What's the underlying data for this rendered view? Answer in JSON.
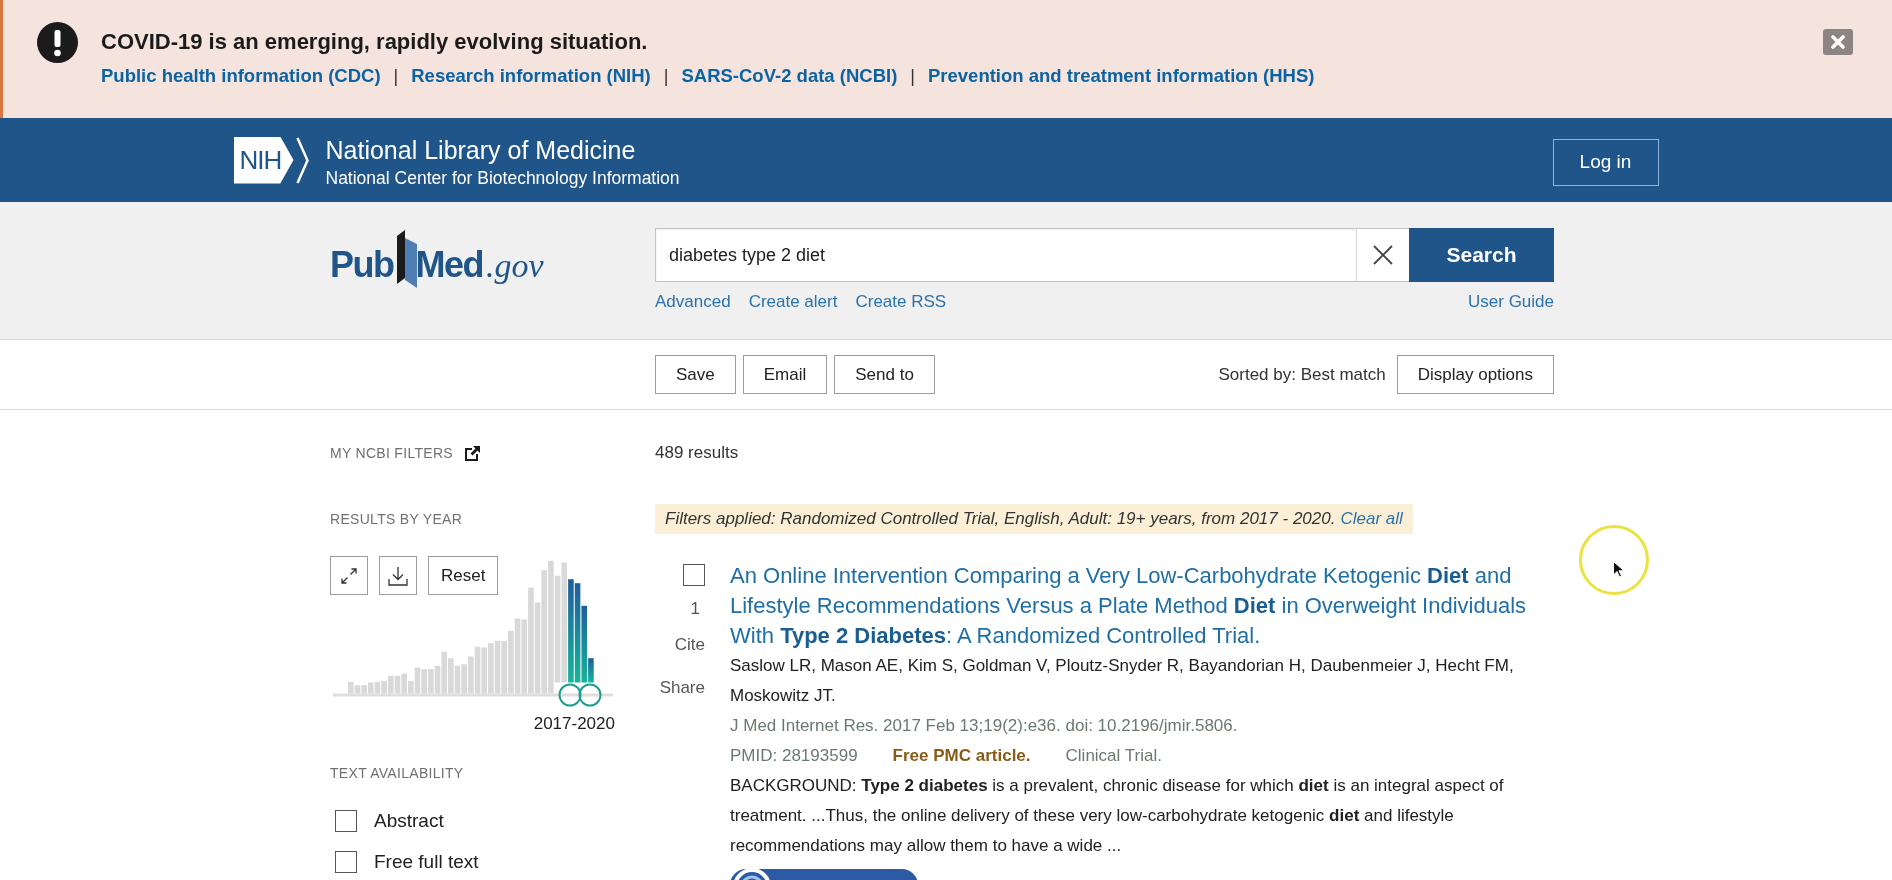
{
  "alert_banner": {
    "title": "COVID-19 is an emerging, rapidly evolving situation.",
    "links": [
      {
        "label": "Public health information (CDC)",
        "separator": "|"
      },
      {
        "label": "Research information (NIH)",
        "separator": "|"
      },
      {
        "label": "SARS-CoV-2 data (NCBI)",
        "separator": "|"
      },
      {
        "label": "Prevention and treatment information (HHS)"
      }
    ]
  },
  "header": {
    "logo_text": "NIH",
    "title": "National Library of Medicine",
    "subtitle": "National Center for Biotechnology Information",
    "login_button": "Log in"
  },
  "search": {
    "logo": {
      "part_1": "Pub",
      "part_2": "Med",
      "domain": ".gov"
    },
    "query": "diabetes type 2 diet",
    "button": "Search",
    "links": [
      "Advanced",
      "Create alert",
      "Create RSS"
    ],
    "help_link": "User Guide"
  },
  "toolbar": {
    "actions": [
      "Save",
      "Email",
      "Send to"
    ],
    "sort_label": "Sorted by: Best match",
    "display_button": "Display options"
  },
  "sidebar": {
    "my_filters": "MY NCBI FILTERS",
    "results_by_year": {
      "heading": "RESULTS BY YEAR",
      "reset_button": "Reset",
      "range_label": "2017-2020",
      "bars": [
        {
          "selected": false
        },
        {
          "selected": false
        },
        {
          "selected": false
        },
        {
          "selected": false
        },
        {
          "selected": false
        },
        {
          "selected": false
        },
        {
          "selected": false
        },
        {
          "selected": false
        },
        {
          "selected": false
        },
        {
          "selected": false
        },
        {
          "selected": false
        },
        {
          "selected": false
        },
        {
          "selected": false
        },
        {
          "selected": false
        },
        {
          "selected": false
        },
        {
          "selected": false
        },
        {
          "selected": false
        },
        {
          "selected": false
        },
        {
          "selected": false
        },
        {
          "selected": false
        },
        {
          "selected": false
        },
        {
          "selected": false
        },
        {
          "selected": false
        },
        {
          "selected": false
        },
        {
          "selected": false
        },
        {
          "selected": false
        },
        {
          "selected": false
        },
        {
          "selected": false
        },
        {
          "selected": false
        },
        {
          "selected": false
        },
        {
          "selected": false
        },
        {
          "selected": false
        },
        {
          "selected": false
        },
        {
          "selected": true
        },
        {
          "selected": true
        },
        {
          "selected": true
        },
        {
          "selected": true
        }
      ]
    },
    "text_availability": {
      "heading": "TEXT AVAILABILITY",
      "options": [
        {
          "label": "Abstract",
          "checked": false
        },
        {
          "label": "Free full text",
          "checked": false
        }
      ]
    }
  },
  "results": {
    "count": "489 results",
    "filters": {
      "text": "Filters applied: Randomized Controlled Trial, English, Adult: 19+ years, from 2017 - 2020.",
      "clear_link": "Clear all"
    },
    "items": [
      {
        "checked": false,
        "number": "1",
        "cite": "Cite",
        "share": "Share",
        "title": "An Online Intervention Comparing a Very Low-Carbohydrate Ketogenic **Diet** and Lifestyle Recommendations Versus a Plate Method **Diet** in Overweight Individuals With **Type 2 Diabetes**: A Randomized Controlled Trial.",
        "authors": "Saslow LR, Mason AE, Kim S, Goldman V, Ploutz-Snyder R, Bayandorian H, Daubenmeier J, Hecht FM, Moskowitz JT.",
        "citation": "J Med Internet Res. 2017 Feb 13;19(2):e36. doi: 10.2196/jmir.5806.",
        "pmid": "PMID: 28193599",
        "free_pmc": "Free PMC article.",
        "publication_type": "Clinical Trial.",
        "snippet": "BACKGROUND: **Type 2 diabetes** is a prevalent, chronic disease for which **diet** is an integral aspect of treatment. ...Thus, the online delivery of these very low-carbohydrate ketogenic **diet** and lifestyle recommendations may allow them to have a wide ..."
      }
    ]
  }
}
